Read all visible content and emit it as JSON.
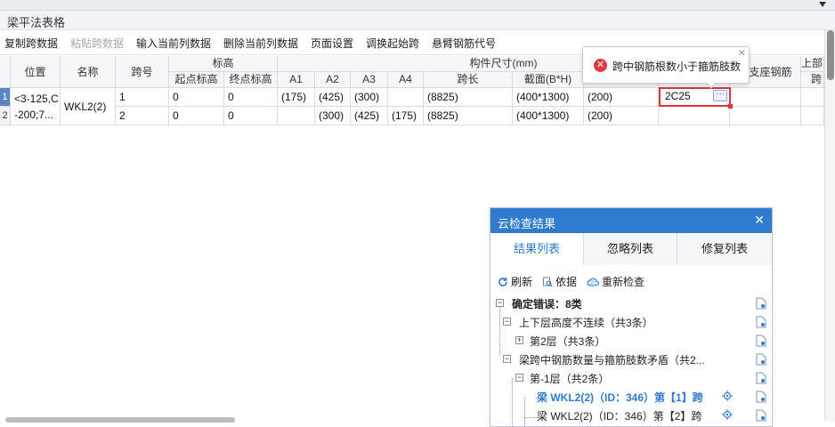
{
  "window": {
    "title": "梁平法表格"
  },
  "toolbar": {
    "copy_span": "复制跨数据",
    "paste_span": "粘贴跨数据",
    "input_col": "输入当前列数据",
    "delete_col": "删除当前列数据",
    "page_setup": "页面设置",
    "swap_start": "调换起始跨",
    "cantilever": "悬臂钢筋代号"
  },
  "grid": {
    "headers": {
      "position": "位置",
      "name": "名称",
      "span_no": "跨号",
      "elevation": "标高",
      "start_elev": "起点标高",
      "end_elev": "终点标高",
      "member_size": "构件尺寸(mm)",
      "a1": "A1",
      "a2": "A2",
      "a3": "A3",
      "a4": "A4",
      "span_len": "跨长",
      "section": "截面(B*H)",
      "right_support": "左支座钢筋",
      "top_label": "上部",
      "top_sub": "跨"
    },
    "rows": [
      {
        "num": "1",
        "pos_line1": "<3-125,C",
        "pos_line2": "-200;7...",
        "name": "WKL2(2)",
        "span": "1",
        "start": "0",
        "end": "0",
        "a1": "(175)",
        "a2": "(425)",
        "a3": "(300)",
        "a4": "",
        "len": "(8825)",
        "section": "(400*1300)",
        "dist": "(200)",
        "edit_value": "2C25"
      },
      {
        "num": "2",
        "span": "2",
        "start": "0",
        "end": "0",
        "a1": "",
        "a2": "(300)",
        "a3": "(425)",
        "a4": "(175)",
        "len": "(8825)",
        "section": "(400*1300)",
        "dist": "(200)"
      }
    ],
    "edit_more": "···"
  },
  "tooltip": {
    "message": "跨中钢筋根数小于箍筋肢数",
    "error_glyph": "✕",
    "close": "✕"
  },
  "panel": {
    "title": "云检查结果",
    "close": "✕",
    "tabs": [
      "结果列表",
      "忽略列表",
      "修复列表"
    ],
    "actions": {
      "refresh": "刷新",
      "basis": "依据",
      "recheck": "重新检查"
    },
    "tree": {
      "root": "确定错误：8类",
      "cat1": "上下层高度不连续（共3条）",
      "cat1_child": "第2层（共3条）",
      "cat2": "梁跨中钢筋数量与箍筋肢数矛盾（共2...",
      "cat2_child": "第-1层（共2条）",
      "item1": "梁 WKL2(2)（ID：346）第【1】跨",
      "item2": "梁 WKL2(2)（ID：346）第【2】跨"
    }
  },
  "colors": {
    "accent": "#2f7bd0",
    "error": "#d9363e",
    "selected_row": "#5b86c4"
  }
}
